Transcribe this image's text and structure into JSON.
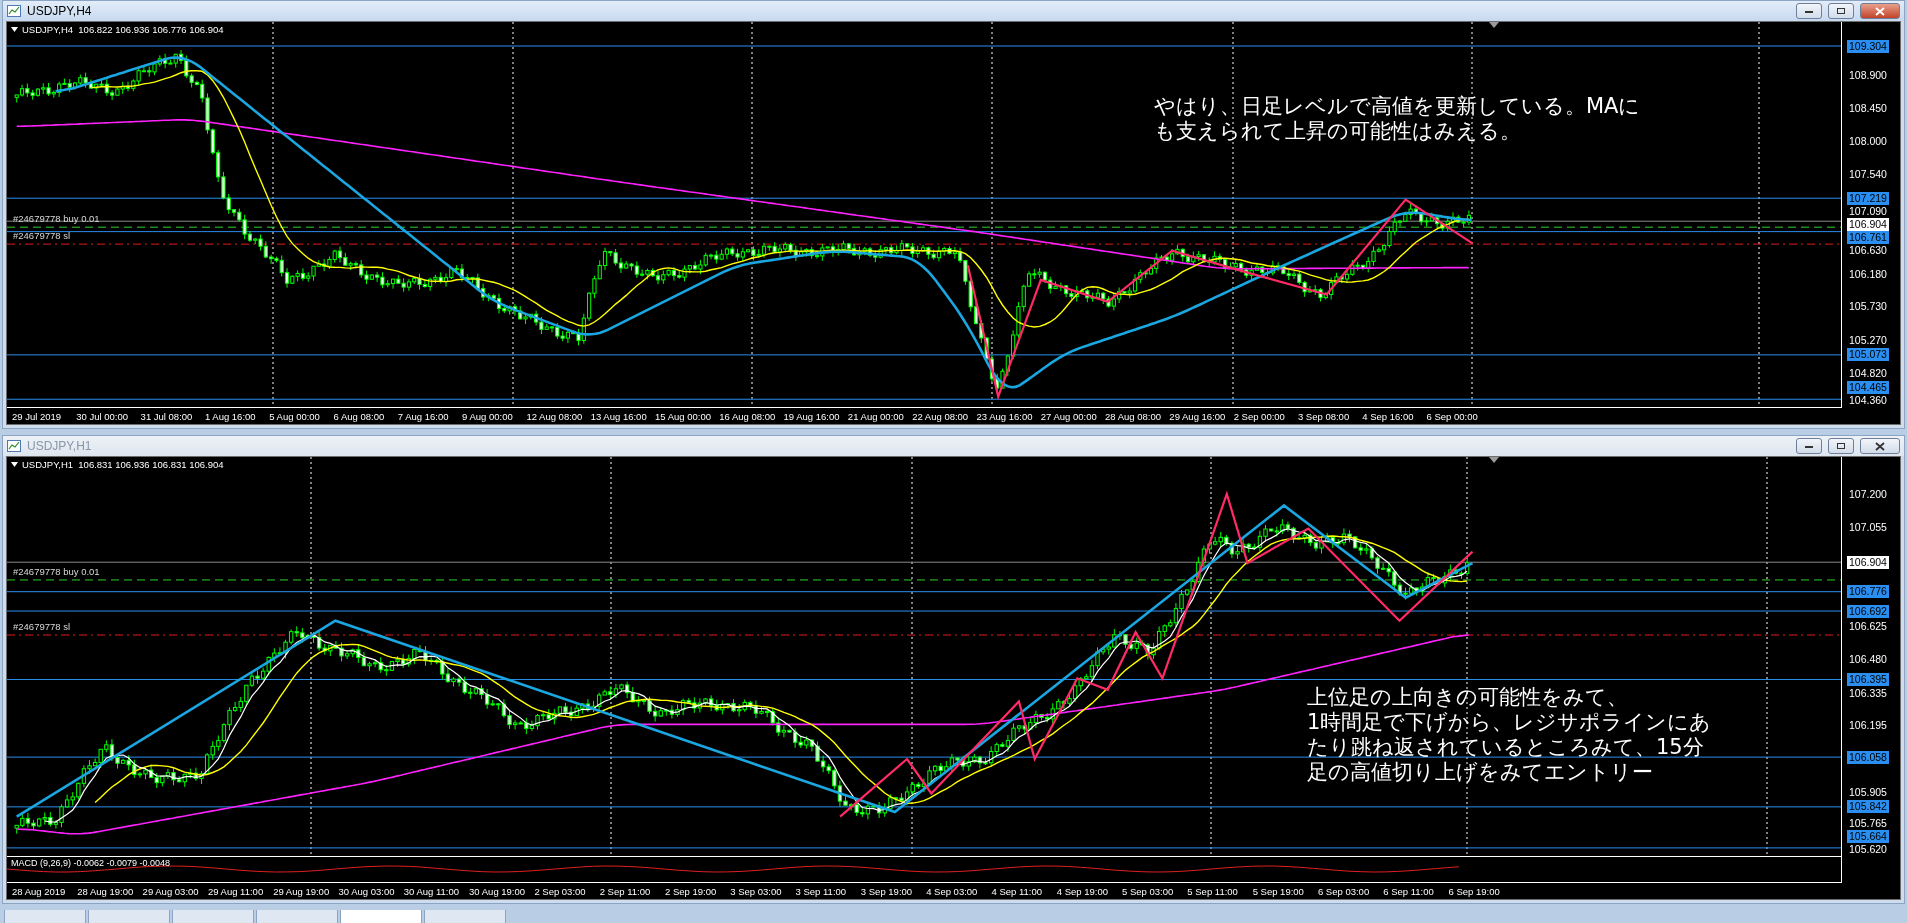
{
  "windows": [
    {
      "title": "USDJPY,H4",
      "active": true,
      "header": "USDJPY,H4  106.822 106.936 106.776 106.904",
      "orders": [
        {
          "text": "#24679778 buy 0.01",
          "kind": "buy"
        },
        {
          "text": "#24679778 sl",
          "kind": "sl"
        }
      ],
      "annotation": [
        "やはり、日足レベルで高値を更新している。MAに",
        "も支えられて上昇の可能性はみえる。"
      ],
      "price_labels": [
        {
          "text": "109.304",
          "kind": "line"
        },
        {
          "text": "108.900",
          "kind": "tick"
        },
        {
          "text": "108.450",
          "kind": "tick"
        },
        {
          "text": "108.000",
          "kind": "tick"
        },
        {
          "text": "107.540",
          "kind": "tick"
        },
        {
          "text": "107.219",
          "kind": "line"
        },
        {
          "text": "107.090",
          "kind": "tick"
        },
        {
          "text": "106.904",
          "kind": "bid"
        },
        {
          "text": "106.761",
          "kind": "line"
        },
        {
          "text": "106.630",
          "kind": "tick"
        },
        {
          "text": "106.180",
          "kind": "tick"
        },
        {
          "text": "105.730",
          "kind": "tick"
        },
        {
          "text": "105.270",
          "kind": "tick"
        },
        {
          "text": "105.073",
          "kind": "line"
        },
        {
          "text": "104.820",
          "kind": "tick"
        },
        {
          "text": "104.465",
          "kind": "line"
        },
        {
          "text": "104.360",
          "kind": "tick"
        }
      ],
      "time_labels": [
        "29 Jul 2019",
        "30 Jul 00:00",
        "31 Jul 08:00",
        "1 Aug 16:00",
        "5 Aug 00:00",
        "6 Aug 08:00",
        "7 Aug 16:00",
        "9 Aug 00:00",
        "12 Aug 08:00",
        "13 Aug 16:00",
        "15 Aug 00:00",
        "16 Aug 08:00",
        "19 Aug 16:00",
        "21 Aug 00:00",
        "22 Aug 08:00",
        "23 Aug 16:00",
        "27 Aug 00:00",
        "28 Aug 08:00",
        "29 Aug 16:00",
        "2 Sep 00:00",
        "3 Sep 08:00",
        "4 Sep 16:00",
        "6 Sep 00:00"
      ]
    },
    {
      "title": "USDJPY,H1",
      "active": false,
      "header": "USDJPY,H1  106.831 106.936 106.831 106.904",
      "orders": [
        {
          "text": "#24679778 buy 0.01",
          "kind": "buy"
        },
        {
          "text": "#24679778 sl",
          "kind": "sl"
        }
      ],
      "annotation": [
        "上位足の上向きの可能性をみて、",
        "1時間足で下げから、レジサポラインにあ",
        "たり跳ね返されているところみて、15分",
        "足の高値切り上げをみてエントリー"
      ],
      "price_labels": [
        {
          "text": "107.200",
          "kind": "tick"
        },
        {
          "text": "107.055",
          "kind": "tick"
        },
        {
          "text": "106.904",
          "kind": "bid"
        },
        {
          "text": "106.776",
          "kind": "line"
        },
        {
          "text": "106.692",
          "kind": "line"
        },
        {
          "text": "106.625",
          "kind": "tick"
        },
        {
          "text": "106.480",
          "kind": "tick"
        },
        {
          "text": "106.395",
          "kind": "line"
        },
        {
          "text": "106.335",
          "kind": "tick"
        },
        {
          "text": "106.195",
          "kind": "tick"
        },
        {
          "text": "106.058",
          "kind": "line"
        },
        {
          "text": "105.905",
          "kind": "tick"
        },
        {
          "text": "105.842",
          "kind": "line"
        },
        {
          "text": "105.765",
          "kind": "tick"
        },
        {
          "text": "105.664",
          "kind": "line"
        },
        {
          "text": "105.620",
          "kind": "tick"
        }
      ],
      "macd_label": "MACD (9,26,9) -0.0062 -0.0079 -0.0048",
      "time_labels": [
        "28 Aug 2019",
        "28 Aug 19:00",
        "29 Aug 03:00",
        "29 Aug 11:00",
        "29 Aug 19:00",
        "30 Aug 03:00",
        "30 Aug 11:00",
        "30 Aug 19:00",
        "2 Sep 03:00",
        "2 Sep 11:00",
        "2 Sep 19:00",
        "3 Sep 03:00",
        "3 Sep 11:00",
        "3 Sep 19:00",
        "4 Sep 03:00",
        "4 Sep 11:00",
        "4 Sep 19:00",
        "5 Sep 03:00",
        "5 Sep 11:00",
        "5 Sep 19:00",
        "6 Sep 03:00",
        "6 Sep 11:00",
        "6 Sep 19:00"
      ]
    }
  ],
  "tabs": [
    {
      "selected": false
    },
    {
      "selected": false
    },
    {
      "selected": false
    },
    {
      "selected": false
    },
    {
      "selected": true
    },
    {
      "selected": false
    }
  ]
}
